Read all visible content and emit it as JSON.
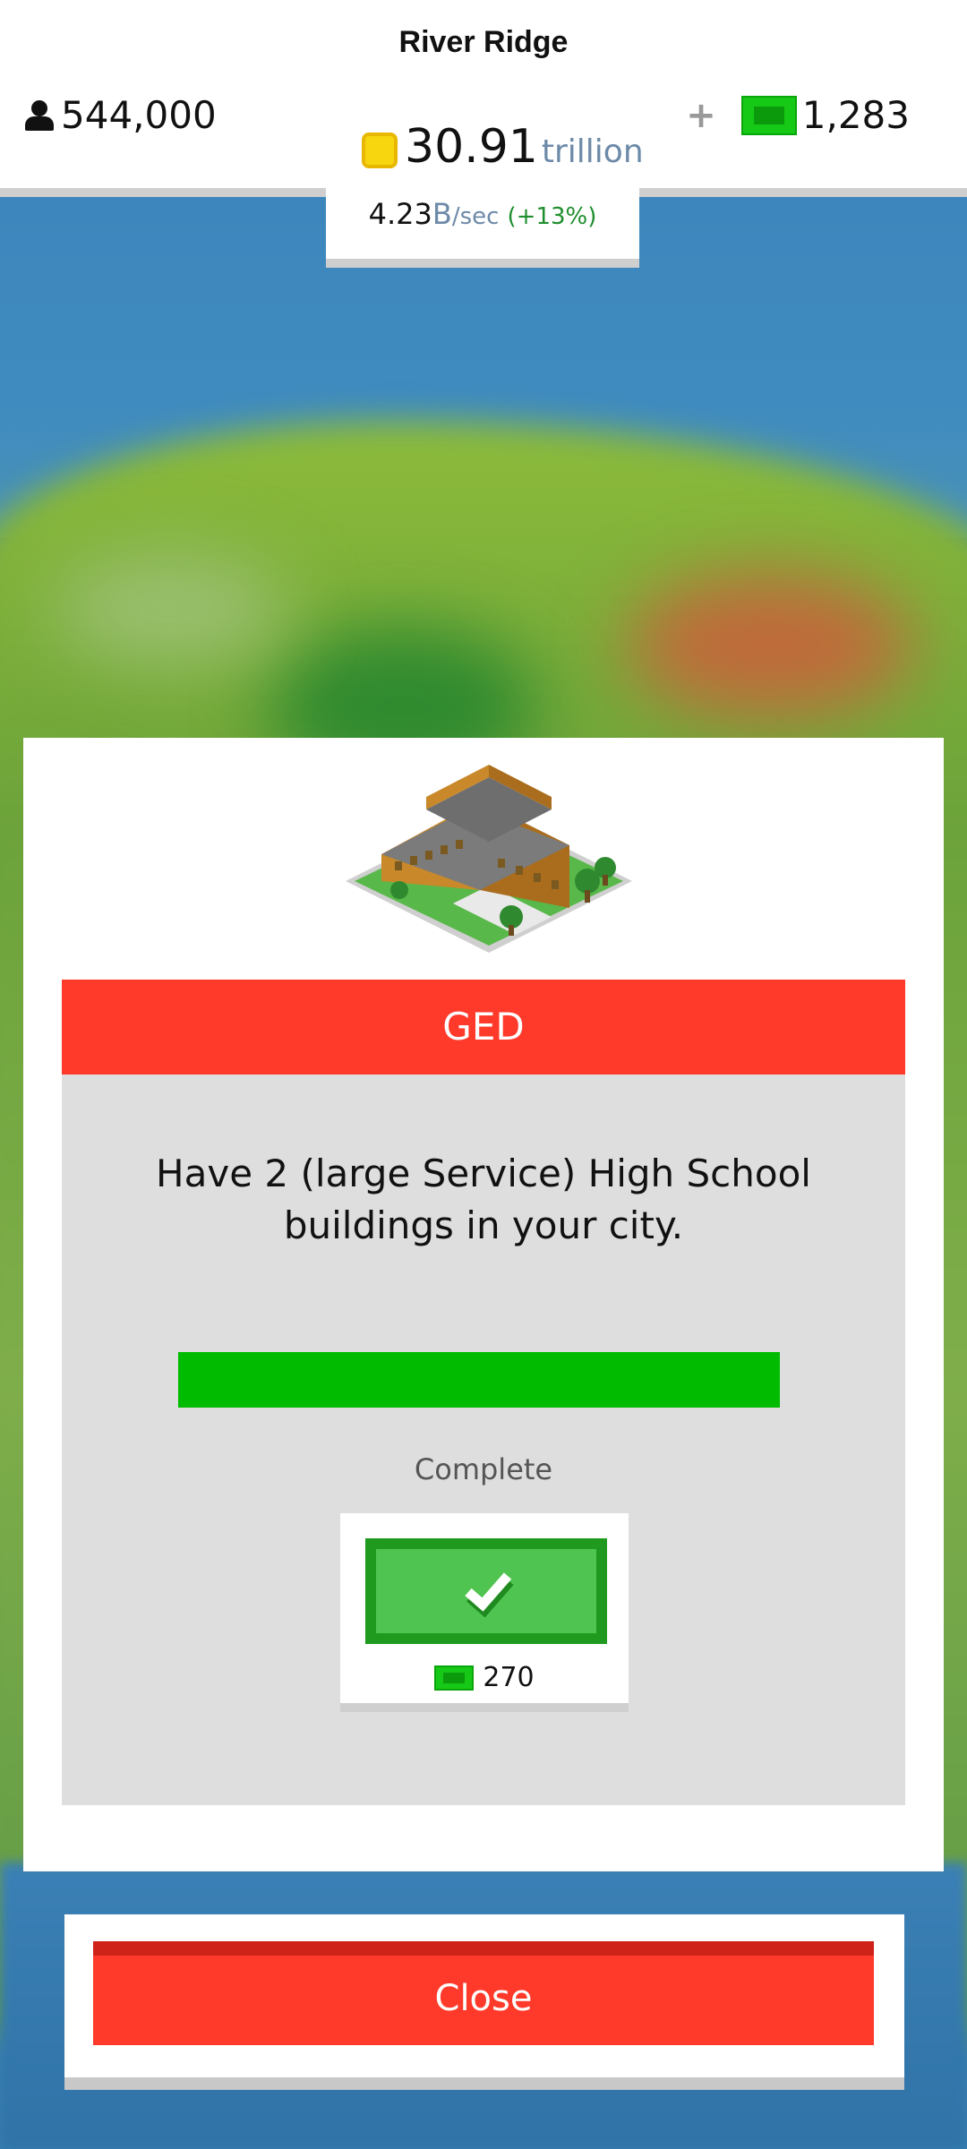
{
  "header": {
    "city_name": "River Ridge",
    "population": "544,000",
    "coins_value": "30.91",
    "coins_unit": "trillion",
    "rate_value": "4.23",
    "rate_unit": "B",
    "rate_per": "/sec",
    "rate_percent": "(+13%)",
    "cash_plus": "+",
    "cash_value": "1,283"
  },
  "dialog": {
    "title": "GED",
    "description": "Have 2 (large Service) High School buildings in your city.",
    "progress_fraction": 1.0,
    "status": "Complete",
    "reward_amount": "270",
    "close_label": "Close"
  },
  "colors": {
    "accent_red": "#ff3a2a",
    "progress_green": "#00bb00",
    "button_green": "#50c450"
  },
  "icons": {
    "population": "person-icon",
    "coins": "coin-icon",
    "cash": "cash-bill-icon",
    "claim": "checkmark-icon",
    "building": "high-school-building-icon"
  }
}
